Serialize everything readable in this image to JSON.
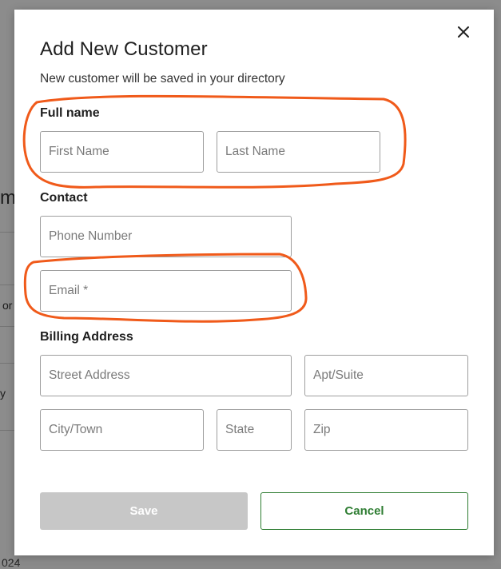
{
  "background": {
    "fragments": [
      "m",
      "or",
      "y",
      "024"
    ]
  },
  "modal": {
    "title": "Add New Customer",
    "subtitle": "New customer will be saved in your directory",
    "close_icon": "close-icon",
    "sections": {
      "full_name": {
        "label": "Full name",
        "first_name_placeholder": "First Name",
        "last_name_placeholder": "Last Name",
        "first_name_value": "",
        "last_name_value": ""
      },
      "contact": {
        "label": "Contact",
        "phone_placeholder": "Phone Number",
        "email_placeholder": "Email *",
        "phone_value": "",
        "email_value": ""
      },
      "billing": {
        "label": "Billing Address",
        "street_placeholder": "Street Address",
        "apt_placeholder": "Apt/Suite",
        "city_placeholder": "City/Town",
        "state_placeholder": "State",
        "zip_placeholder": "Zip"
      }
    },
    "buttons": {
      "save_label": "Save",
      "cancel_label": "Cancel"
    }
  },
  "colors": {
    "annotation": "#f05a1a",
    "cancel_green": "#2e7d32",
    "save_disabled": "#c7c7c7"
  }
}
